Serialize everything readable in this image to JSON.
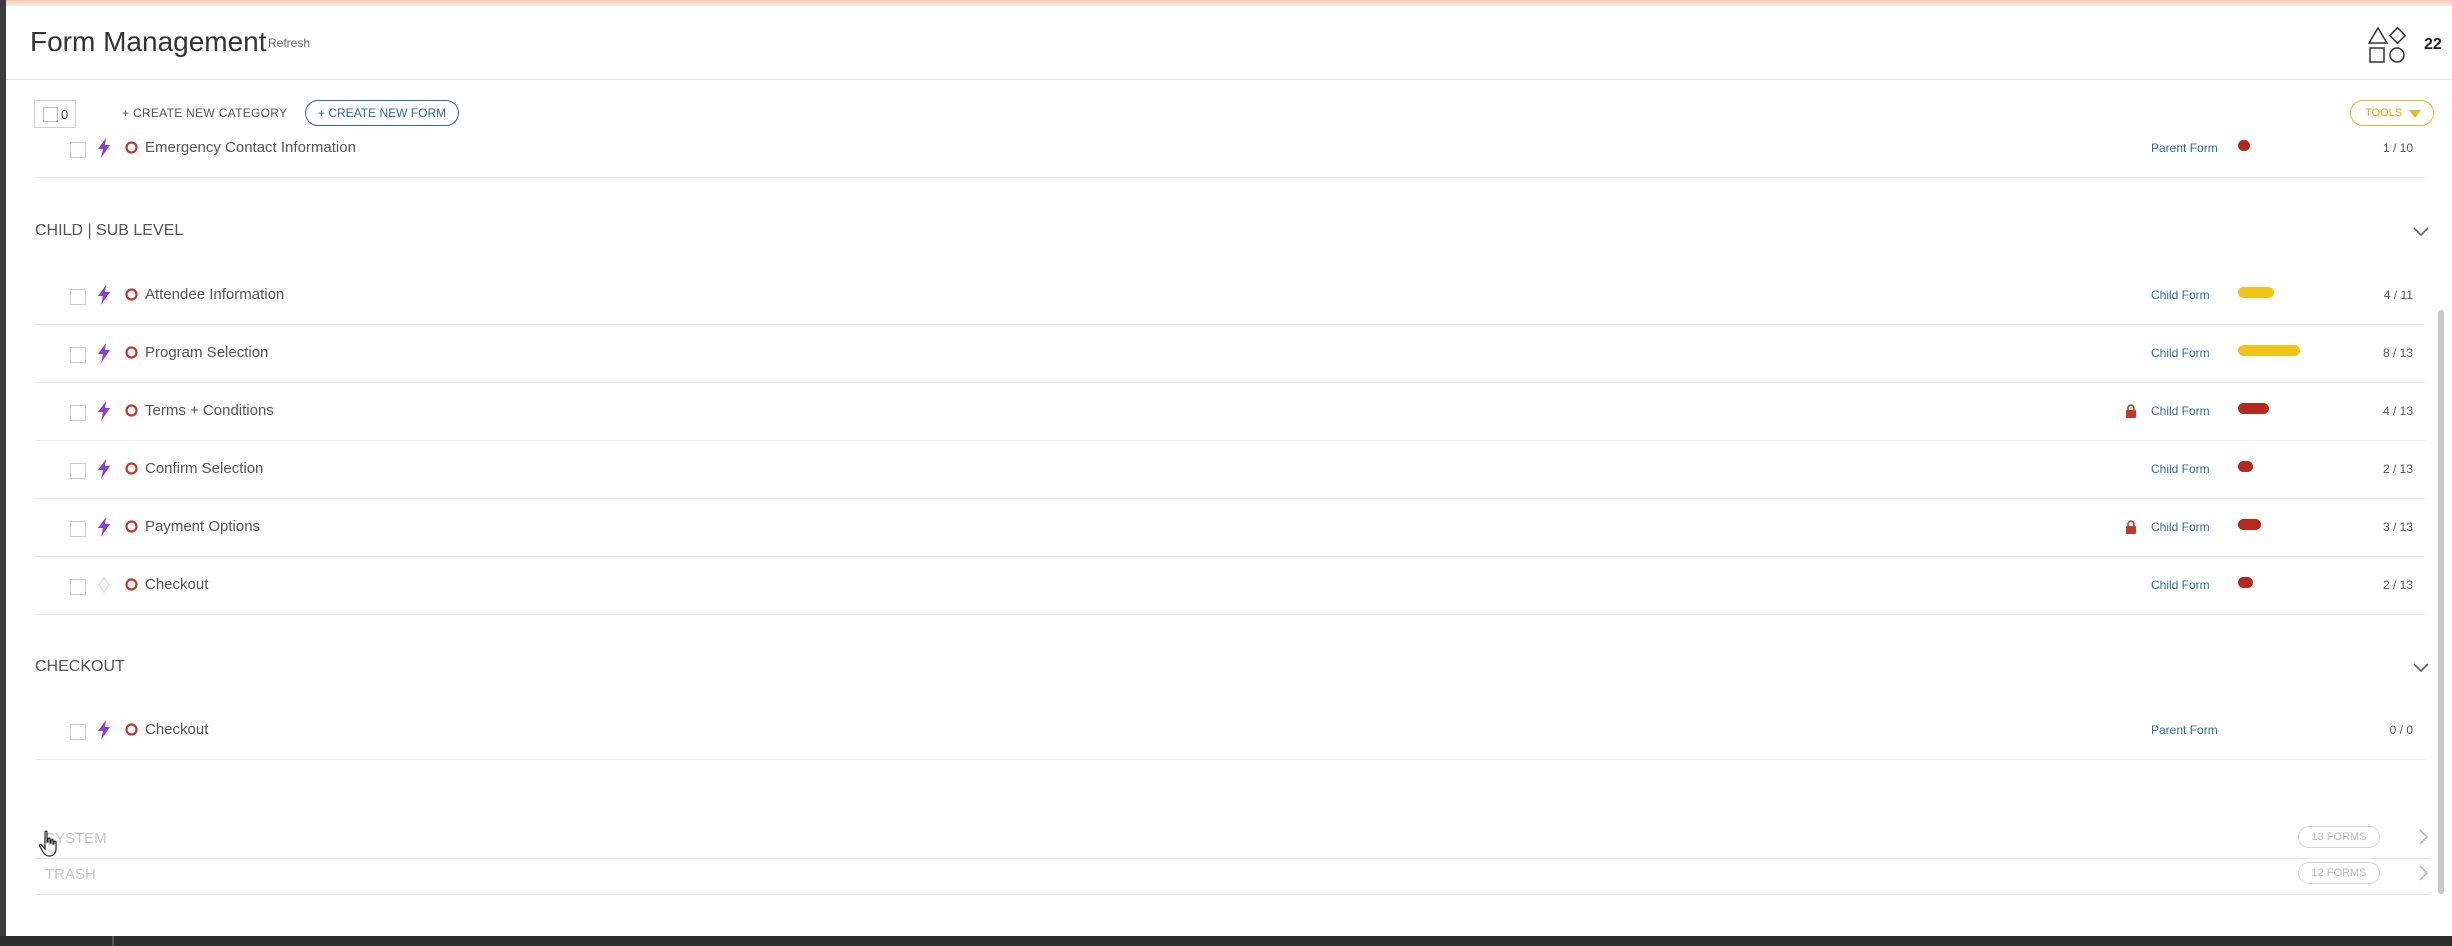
{
  "header": {
    "title": "Form Management",
    "refresh_label": "Refresh",
    "count": "22"
  },
  "toolbar": {
    "selected_count": "0",
    "create_category_label": "+ CREATE NEW CATEGORY",
    "create_form_label": "+ CREATE NEW FORM",
    "tools_label": "TOOLS"
  },
  "parent_rows": [
    {
      "name": "Emergency Contact Information",
      "type": "Parent Form",
      "ratio": "1 / 10",
      "locked": false,
      "bolt": true,
      "progress": 0.08,
      "status_color": "#b5281f"
    }
  ],
  "categories": [
    {
      "title": "CHILD | SUB LEVEL",
      "rows": [
        {
          "name": "Attendee Information",
          "type": "Child Form",
          "ratio": "4 / 11",
          "locked": false,
          "bolt": true,
          "progress": 0.36,
          "status_color": "#f0c419"
        },
        {
          "name": "Program Selection",
          "type": "Child Form",
          "ratio": "8 / 13",
          "locked": false,
          "bolt": true,
          "progress": 0.62,
          "status_color": "#f0c419"
        },
        {
          "name": "Terms + Conditions",
          "type": "Child Form",
          "ratio": "4 / 13",
          "locked": true,
          "bolt": true,
          "progress": 0.31,
          "status_color": "#b5281f"
        },
        {
          "name": "Confirm Selection",
          "type": "Child Form",
          "ratio": "2 / 13",
          "locked": false,
          "bolt": true,
          "progress": 0.15,
          "status_color": "#b5281f"
        },
        {
          "name": "Payment Options",
          "type": "Child Form",
          "ratio": "3 / 13",
          "locked": true,
          "bolt": true,
          "progress": 0.23,
          "status_color": "#b5281f"
        },
        {
          "name": "Checkout",
          "type": "Child Form",
          "ratio": "2 / 13",
          "locked": false,
          "bolt": false,
          "progress": 0.15,
          "status_color": "#b5281f"
        }
      ]
    },
    {
      "title": "CHECKOUT",
      "rows": [
        {
          "name": "Checkout",
          "type": "Parent Form",
          "ratio": "0 / 0",
          "locked": false,
          "bolt": true,
          "progress": 0,
          "status_color": "#b5281f"
        }
      ]
    }
  ],
  "system_sections": [
    {
      "title": "SYSTEM",
      "badge": "13 FORMS"
    },
    {
      "title": "TRASH",
      "badge": "12 FORMS"
    }
  ]
}
